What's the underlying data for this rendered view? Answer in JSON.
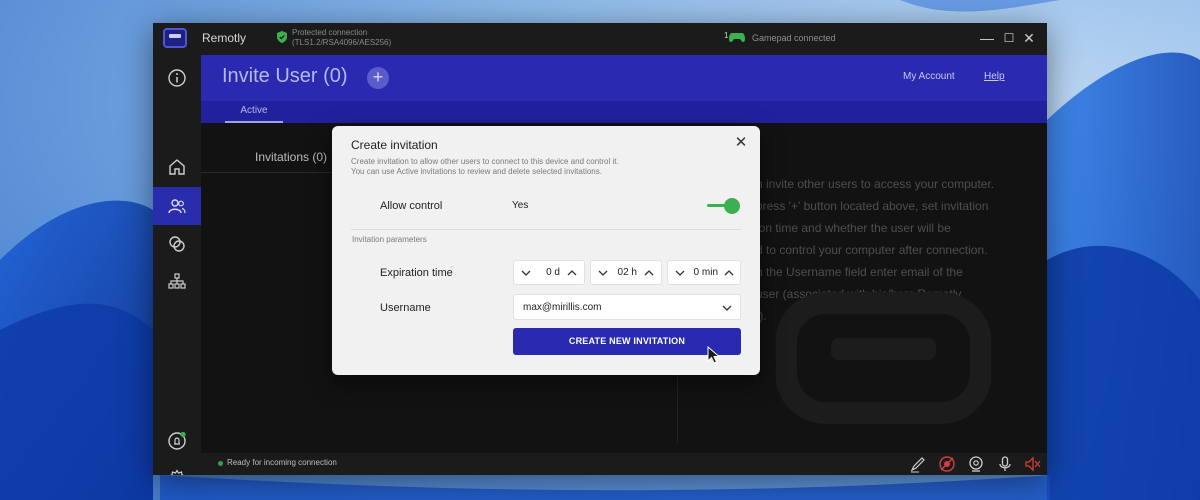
{
  "app": {
    "name": "Remotly",
    "connection_line1": "Protected connection",
    "connection_line2": "(TLS1.2/RSA4096/AES256)",
    "gamepad_count": "1",
    "gamepad_status": "Gamepad connected"
  },
  "window_controls": {
    "minimize": "—",
    "maximize": "☐",
    "close": "✕"
  },
  "header": {
    "title": "Invite User (0)",
    "add_label": "+",
    "my_account": "My Account",
    "help": "Help"
  },
  "tabs": [
    {
      "label": "Active"
    }
  ],
  "list": {
    "invitations_label": "Invitations (0)"
  },
  "help_text": {
    "line1": "n invite other users to access your computer.",
    "line2": "press '+' button located above, set invitation",
    "line3": "ion time and whether the user will be",
    "line4": "d to control your computer after connection.",
    "line5": "n the Username field enter email of the",
    "line6": "user (associated with his/hers Remotly",
    "line7": "t)."
  },
  "status": {
    "text": "Ready for incoming connection",
    "dot_color": "#2fa24b"
  },
  "modal": {
    "title": "Create invitation",
    "close_label": "✕",
    "desc_line1": "Create invitation to allow other users to connect to this device and control it.",
    "desc_line2": "You can use Active invitations to review and delete selected invitations.",
    "allow_control_label": "Allow control",
    "allow_control_value": "Yes",
    "allow_control_on": true,
    "section_label": "Invitation parameters",
    "expiration_label": "Expiration time",
    "expiration": {
      "days": "0 d",
      "hours": "02 h",
      "minutes": "0 min"
    },
    "username_label": "Username",
    "username_value": "max@mirillis.com",
    "create_button": "CREATE NEW INVITATION"
  },
  "colors": {
    "accent": "#2a2ab0",
    "toggle_on": "#3bb04f",
    "window_bg": "#1b1b1b"
  },
  "icons": {
    "sidebar": [
      "info-icon",
      "home-icon",
      "users-icon",
      "devices-icon",
      "network-icon",
      "notification-icon",
      "settings-icon"
    ],
    "statusbar": [
      "pen-icon",
      "record-icon",
      "webcam-icon",
      "microphone-icon",
      "speaker-muted-icon"
    ]
  }
}
